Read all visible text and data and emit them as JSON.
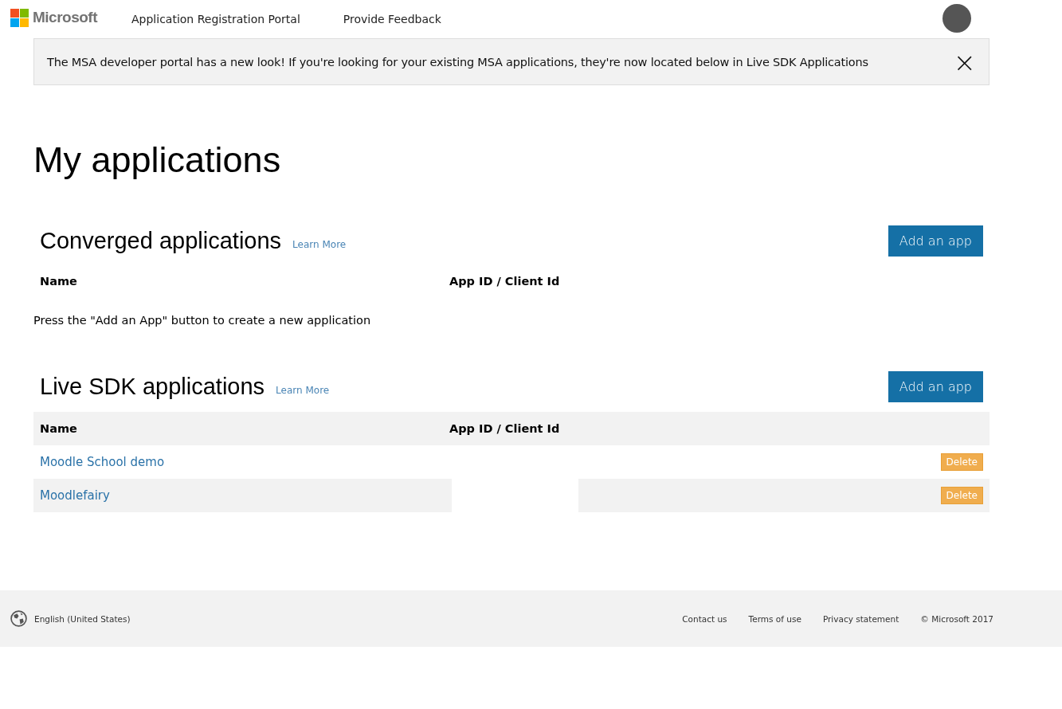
{
  "header": {
    "brand": "Microsoft",
    "nav": [
      "Application Registration Portal",
      "Provide Feedback"
    ]
  },
  "notice": {
    "text": "The MSA developer portal has a new look! If you're looking for your existing MSA applications, they're now located below in Live SDK Applications",
    "close": "×"
  },
  "page_title": "My applications",
  "sections": [
    {
      "title": "Converged applications",
      "learn_more": "Learn More",
      "add_button": "Add an app",
      "columns": [
        "Name",
        "App ID / Client Id"
      ],
      "empty_message": "Press the \"Add an App\" button to create a new application"
    },
    {
      "title": "Live SDK applications",
      "learn_more": "Learn More",
      "add_button": "Add an app",
      "columns": [
        "Name",
        "App ID / Client Id"
      ],
      "rows": [
        {
          "name": "Moodle School demo",
          "delete": "Delete"
        },
        {
          "name": "Moodlefairy",
          "delete": "Delete"
        }
      ]
    }
  ],
  "footer": {
    "language": "English (United States)",
    "links": [
      "Contact us",
      "Terms of use",
      "Privacy statement"
    ],
    "copyright": "© Microsoft 2017"
  }
}
